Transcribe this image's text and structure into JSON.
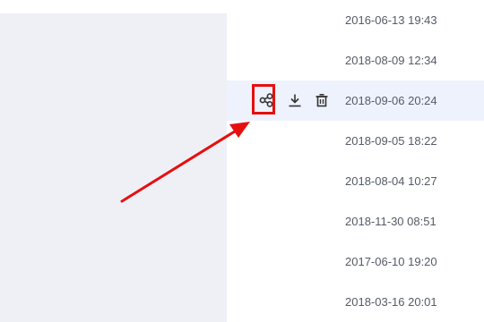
{
  "file_list": {
    "rows": [
      {
        "modified": "2016-06-13 19:43"
      },
      {
        "modified": "2018-08-09 12:34"
      },
      {
        "modified": "2018-09-06 20:24"
      },
      {
        "modified": "2018-09-05 18:22"
      },
      {
        "modified": "2018-08-04 10:27"
      },
      {
        "modified": "2018-11-30 08:51"
      },
      {
        "modified": "2017-06-10 19:20"
      },
      {
        "modified": "2018-03-16 20:01"
      }
    ],
    "hovered_row_index": 2,
    "hover_row_color": "#eef2fc",
    "row_actions": {
      "share_icon": "share-icon",
      "download_icon": "download-icon",
      "delete_icon": "trash-icon"
    }
  },
  "annotation": {
    "highlight_target": "share-button",
    "color": "#e60f0f"
  },
  "colors": {
    "left_panel": "#eff0f6",
    "date_text": "#555b66",
    "icon": "#333333"
  }
}
